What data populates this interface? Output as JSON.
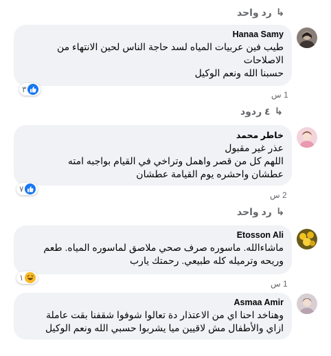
{
  "colors": {
    "bubble": "#f0f2f5",
    "muted": "#65676b",
    "like_blue": "#1877f2",
    "haha_yellow": "#f7b928"
  },
  "top_reply": {
    "label": "رد واحد",
    "icon": "reply-arrow-icon"
  },
  "comments": [
    {
      "author": "Hanaa Samy",
      "lines": [
        "طيب فين عربيات المياه لسد حاجة الناس لحين الانتهاء من",
        "الاصلاحات",
        "حسبنا الله ونعم الوكيل"
      ],
      "reaction": {
        "type": "like",
        "count": "٣"
      },
      "time": "1 س",
      "replies": {
        "label": "٤ ردود",
        "icon": "reply-arrow-icon"
      }
    },
    {
      "author": "خاطر محمد",
      "lines": [
        "عذر غير مقبول",
        "اللهم كل من قصر واهمل وتراخي في القيام بواجبه امته",
        "عطشان واحشره يوم القيامة عطشان"
      ],
      "reaction": {
        "type": "like",
        "count": "٧"
      },
      "time": "2 س",
      "replies": {
        "label": "رد واحد",
        "icon": "reply-arrow-icon"
      }
    },
    {
      "author": "Etosson Ali",
      "lines": [
        "ماشاءالله. ماسوره صرف صحي ملاصق لماسوره المياه. طعم",
        "وريحه وترميله كله طبيعي. رحمتك يارب"
      ],
      "reaction": {
        "type": "haha",
        "count": "١"
      },
      "time": "1 س"
    },
    {
      "author": "Asmaa Amir",
      "lines": [
        "وهناخد احنا اي من الاعتذار دة تعالوا شوفوا شقفنا بقت عاملة",
        "ازاي والأطفال مش لاقيين ميا يشربوا حسبي الله ونعم الوكيل"
      ]
    }
  ]
}
